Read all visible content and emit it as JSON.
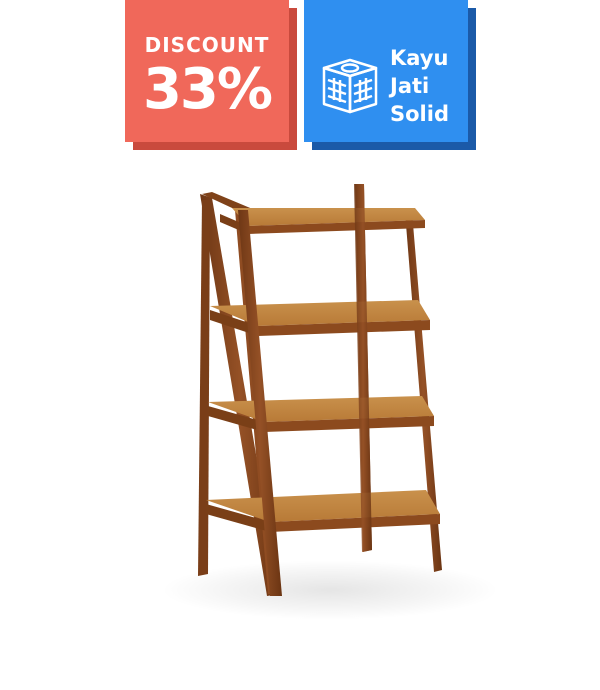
{
  "discount_badge": {
    "label": "DISCOUNT",
    "value": "33%",
    "color": "#f0685a",
    "shadow_color": "#c94a3d"
  },
  "material_badge": {
    "icon": "wood-block-icon",
    "line1": "Kayu",
    "line2": "Jati",
    "line3": "Solid",
    "color": "#2f8ff0",
    "shadow_color": "#1b5aa8"
  },
  "product": {
    "image": "ladder-shelf-image",
    "wood_color": "#8a4b22",
    "shelf_color": "#c58a45"
  }
}
